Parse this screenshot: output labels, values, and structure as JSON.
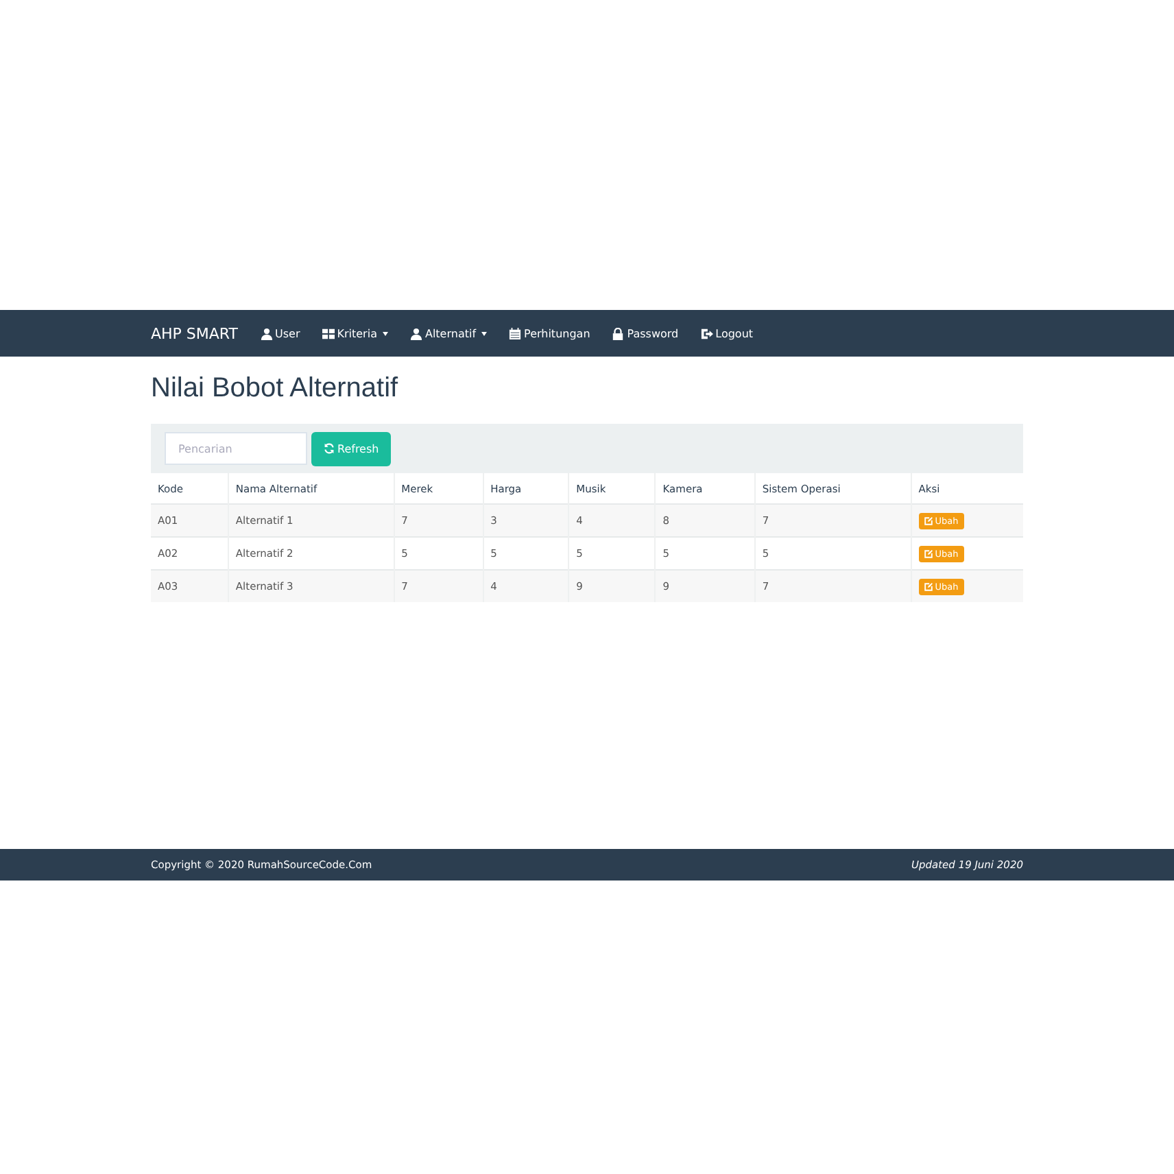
{
  "navbar": {
    "brand": "AHP SMART",
    "items": [
      {
        "label": "User",
        "dropdown": false
      },
      {
        "label": "Kriteria",
        "dropdown": true
      },
      {
        "label": "Alternatif",
        "dropdown": true
      },
      {
        "label": "Perhitungan",
        "dropdown": false
      },
      {
        "label": "Password",
        "dropdown": false
      },
      {
        "label": "Logout",
        "dropdown": false
      }
    ]
  },
  "title": "Nilai Bobot Alternatif",
  "toolbar": {
    "search": {
      "placeholder": "Pencarian"
    },
    "refresh_button": "Refresh"
  },
  "table": {
    "columns": [
      "Kode",
      "Nama Alternatif",
      "Merek",
      "Harga",
      "Musik",
      "Kamera",
      "Sistem Operasi",
      "Aksi"
    ],
    "rows": [
      {
        "cells": [
          "A01",
          "Alternatif 1",
          "7",
          "3",
          "4",
          "8",
          "7"
        ],
        "action": "Ubah"
      },
      {
        "cells": [
          "A02",
          "Alternatif 2",
          "5",
          "5",
          "5",
          "5",
          "5"
        ],
        "action": "Ubah"
      },
      {
        "cells": [
          "A03",
          "Alternatif 3",
          "7",
          "4",
          "9",
          "9",
          "7"
        ],
        "action": "Ubah"
      }
    ]
  },
  "footer": {
    "copyright": "Copyright © 2020 RumahSourceCode.Com",
    "updated": "Updated 19 Juni 2020"
  }
}
